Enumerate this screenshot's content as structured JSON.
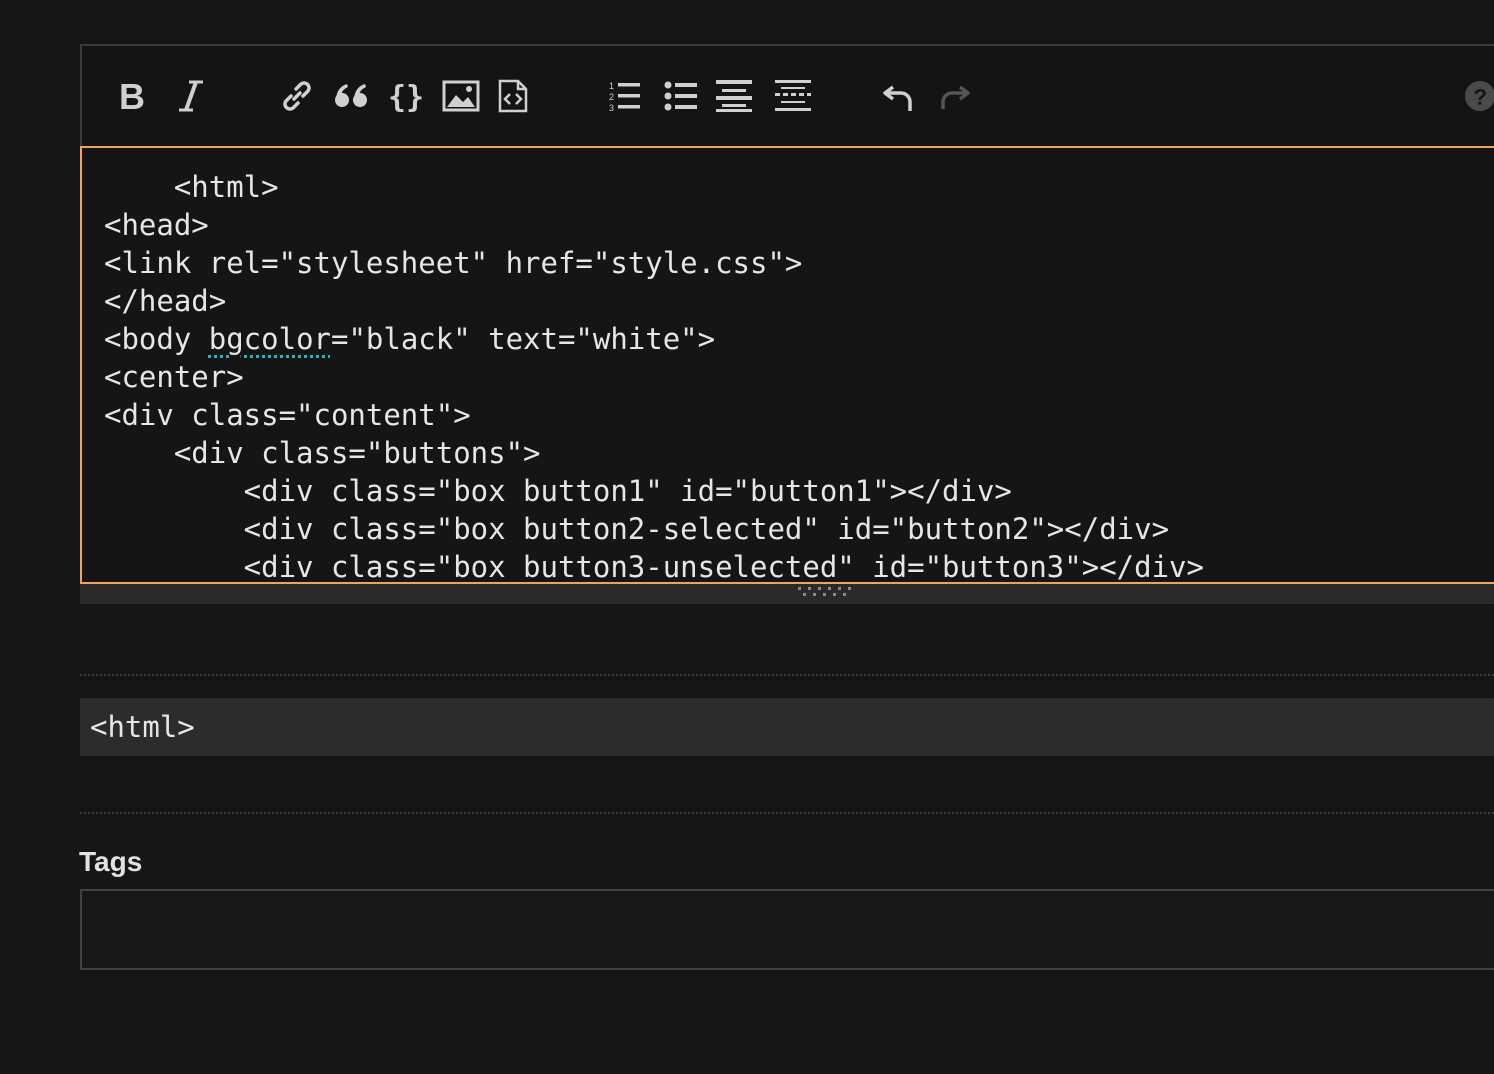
{
  "editor": {
    "toolbar": [
      {
        "name": "bold-button",
        "icon": "bold-icon"
      },
      {
        "name": "italic-button",
        "icon": "italic-icon"
      },
      {
        "name": "link-button",
        "icon": "link-icon"
      },
      {
        "name": "blockquote-button",
        "icon": "quote-icon"
      },
      {
        "name": "code-button",
        "icon": "braces-icon"
      },
      {
        "name": "image-button",
        "icon": "image-icon"
      },
      {
        "name": "snippet-button",
        "icon": "code-file-icon"
      },
      {
        "name": "numbered-list-button",
        "icon": "numbered-list-icon"
      },
      {
        "name": "bulleted-list-button",
        "icon": "bulleted-list-icon"
      },
      {
        "name": "heading-button",
        "icon": "heading-icon"
      },
      {
        "name": "horizontal-rule-button",
        "icon": "horizontal-rule-icon"
      },
      {
        "name": "undo-button",
        "icon": "undo-icon"
      },
      {
        "name": "redo-button",
        "icon": "redo-icon"
      },
      {
        "name": "help-button",
        "icon": "help-icon"
      }
    ],
    "code_lines": [
      "    <html>",
      "<head>",
      "<link rel=\"stylesheet\" href=\"style.css\">",
      "</head>",
      "<body bgcolor=\"black\" text=\"white\">",
      "<center>",
      "<div class=\"content\">",
      "    <div class=\"buttons\">",
      "        <div class=\"box button1\" id=\"button1\"></div>",
      "        <div class=\"box button2-selected\" id=\"button2\"></div>",
      "        <div class=\"box button3-unselected\" id=\"button3\"></div>"
    ],
    "spellcheck_word": "bgcolor"
  },
  "preview": {
    "text": "<html>"
  },
  "tags": {
    "label": "Tags",
    "value": "",
    "placeholder": ""
  },
  "colors": {
    "background": "#161616",
    "focus_border": "#f0a35a",
    "spellcheck_underline": "#27b3c2",
    "icon": "#d0d0d0",
    "icon_disabled": "#555555"
  }
}
